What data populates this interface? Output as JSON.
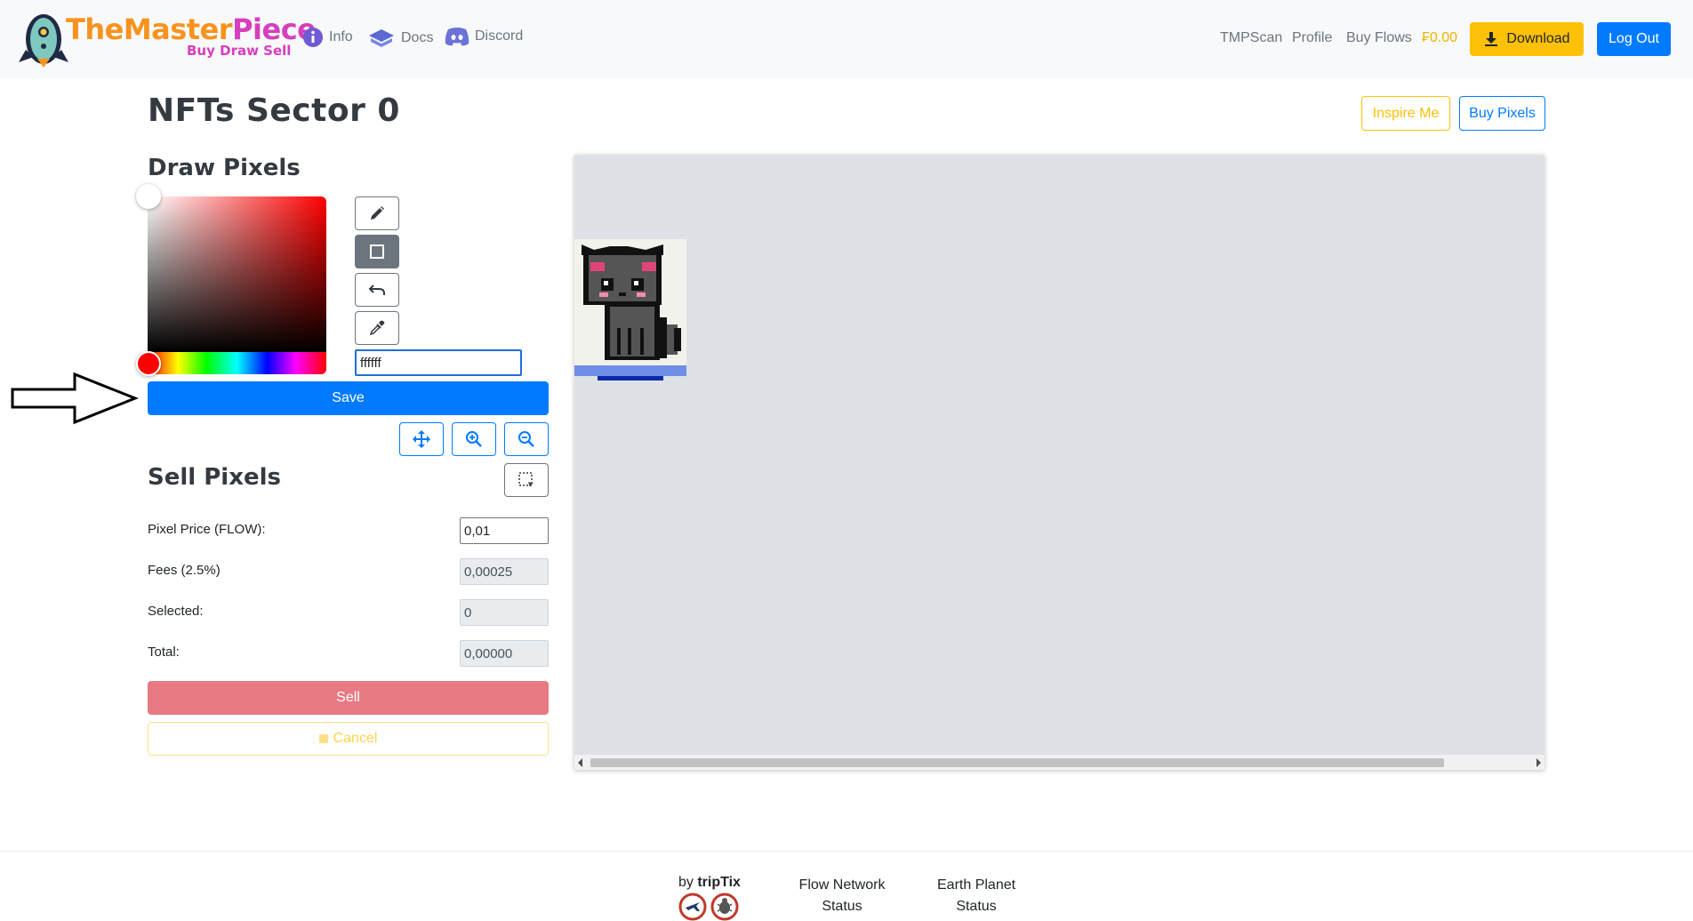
{
  "brand": {
    "title_the": "The",
    "title_master": "Master",
    "title_piece": "Piece",
    "subtitle": "Buy Draw Sell"
  },
  "nav": {
    "info": "Info",
    "docs": "Docs",
    "discord": "Discord",
    "tmpscan": "TMPScan",
    "profile": "Profile",
    "buy_flows": "Buy Flows",
    "balance": "₣0.00",
    "download": "Download",
    "logout": "Log Out"
  },
  "page": {
    "title": "NFTs Sector 0",
    "inspire_me": "Inspire Me",
    "buy_pixels": "Buy Pixels"
  },
  "draw": {
    "heading": "Draw Pixels",
    "hex_value": "ffffff",
    "save": "Save",
    "selected_color": "#ff0000"
  },
  "sell": {
    "heading": "Sell Pixels",
    "price_label": "Pixel Price (FLOW):",
    "price_value": "0,01",
    "fees_label": "Fees (2.5%)",
    "fees_value": "0,00025",
    "selected_label": "Selected:",
    "selected_value": "0",
    "total_label": "Total:",
    "total_value": "0,00000",
    "sell": "Sell",
    "cancel": "Cancel"
  },
  "footer": {
    "by": "by ",
    "by_name": "tripTix",
    "flow_line1": "Flow Network",
    "flow_line2": "Status",
    "earth_line1": "Earth Planet",
    "earth_line2": "Status"
  },
  "colors": {
    "primary": "#007bff",
    "warning": "#ffc107",
    "danger_light": "#e87a84",
    "canvas_bg": "#dee1e6"
  }
}
